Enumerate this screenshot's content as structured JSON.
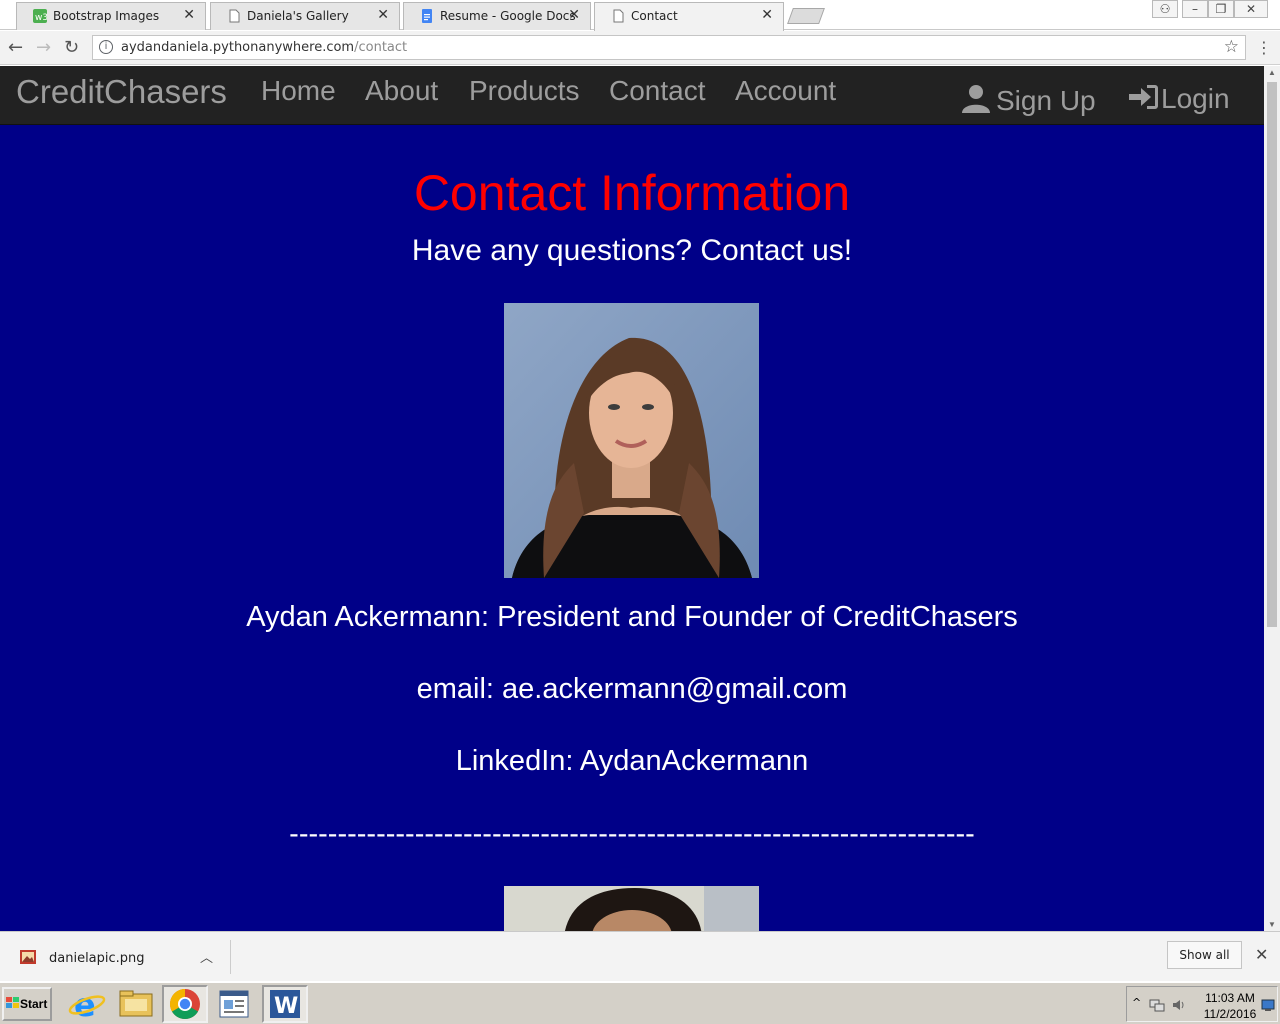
{
  "browser": {
    "tabs": [
      {
        "title": "Bootstrap Images",
        "icon": "w3schools-icon",
        "active": false
      },
      {
        "title": "Daniela's Gallery",
        "icon": "page-icon",
        "active": false
      },
      {
        "title": "Resume - Google Docs",
        "icon": "docs-icon",
        "active": false
      },
      {
        "title": "Contact",
        "icon": "page-icon",
        "active": true
      }
    ],
    "url_host": "aydandaniela.pythonanywhere.com",
    "url_path": "/contact"
  },
  "site": {
    "brand": "CreditChasers",
    "nav": [
      "Home",
      "About",
      "Products",
      "Contact",
      "Account"
    ],
    "sign_up": "Sign Up",
    "login": "Login",
    "colors": {
      "background": "#000088",
      "title": "#ff0000",
      "navbar": "#222222"
    }
  },
  "contact": {
    "title": "Contact Information",
    "subtitle": "Have any questions? Contact us!",
    "name_line": "Aydan Ackermann: President and Founder of CreditChasers",
    "email_line": "email: ae.ackermann@gmail.com",
    "linkedin_line": "LinkedIn: AydanAckermann",
    "separator": "-----------------------------------------------------------------------"
  },
  "downloads": {
    "file_name": "danielapic.png",
    "show_all": "Show all"
  },
  "taskbar": {
    "start": "Start",
    "time": "11:03 AM",
    "date": "11/2/2016"
  }
}
